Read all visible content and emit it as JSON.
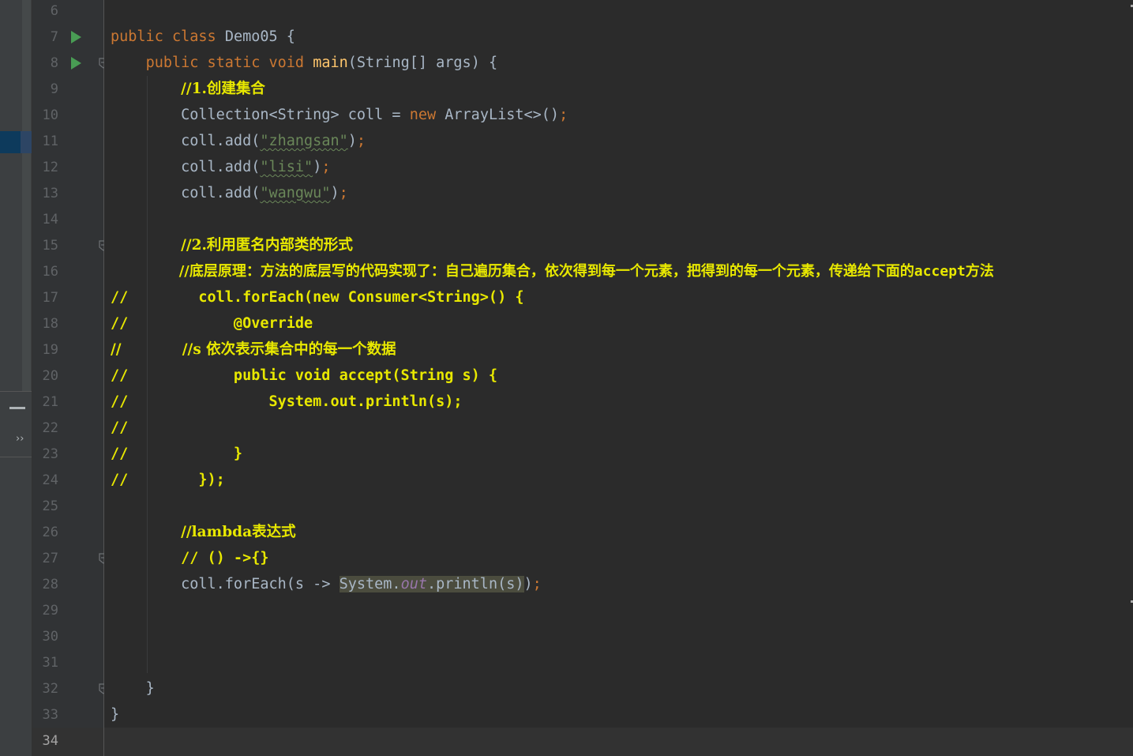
{
  "toolstrip": {
    "minimize_icon": "minus-icon",
    "expand_icon": "double-chevron-right-icon",
    "expand_glyph": "››"
  },
  "gutter": {
    "lines": [
      {
        "n": "6"
      },
      {
        "n": "7",
        "run": true
      },
      {
        "n": "8",
        "run": true,
        "fold": true
      },
      {
        "n": "9"
      },
      {
        "n": "10"
      },
      {
        "n": "11"
      },
      {
        "n": "12"
      },
      {
        "n": "13"
      },
      {
        "n": "14"
      },
      {
        "n": "15",
        "fold": true
      },
      {
        "n": "16"
      },
      {
        "n": "17"
      },
      {
        "n": "18"
      },
      {
        "n": "19"
      },
      {
        "n": "20"
      },
      {
        "n": "21"
      },
      {
        "n": "22"
      },
      {
        "n": "23"
      },
      {
        "n": "24"
      },
      {
        "n": "25"
      },
      {
        "n": "26"
      },
      {
        "n": "27",
        "fold": true
      },
      {
        "n": "28"
      },
      {
        "n": "29"
      },
      {
        "n": "30"
      },
      {
        "n": "31"
      },
      {
        "n": "32",
        "fold": true
      },
      {
        "n": "33"
      },
      {
        "n": "34",
        "current": true
      }
    ]
  },
  "code": {
    "l7_public": "public",
    "l7_class": "class",
    "l7_name": "Demo05 {",
    "l8_public": "public",
    "l8_static": "static",
    "l8_void": "void",
    "l8_main": "main",
    "l8_params": "(String[] args) {",
    "l9": "//1.创建集合",
    "l10_a": "Collection<String> coll = ",
    "l10_new": "new",
    "l10_b": " ArrayList<>()",
    "l10_semi": ";",
    "l11_a": "coll.add(",
    "l11_str": "\"zhangsan\"",
    "l11_b": ")",
    "l11_semi": ";",
    "l12_a": "coll.add(",
    "l12_str": "\"lisi\"",
    "l12_b": ")",
    "l12_semi": ";",
    "l13_a": "coll.add(",
    "l13_str": "\"wangwu\"",
    "l13_b": ")",
    "l13_semi": ";",
    "l15": "//2.利用匿名内部类的形式",
    "l16_a": "//底层原理：方法的底层写的代码实现了：自己遍历集合，依次得到每一个元素，把得到的每一个元素，传递给下面的",
    "l16_b": "accept",
    "l16_c": "方法",
    "l17": "//        coll.forEach(new Consumer<String>() {",
    "l18": "//            @Override",
    "l19": "//            //s 依次表示集合中的每一个数据",
    "l20": "//            public void accept(String s) {",
    "l21": "//                System.out.println(s);",
    "l22": "//",
    "l23": "//            }",
    "l24": "//        });",
    "l26": "//lambda表达式",
    "l27": "// () ->{}",
    "l28_a": "coll.forEach(s -> ",
    "l28_sys": "System.",
    "l28_out": "out",
    "l28_println": ".println(s)",
    "l28_b": ")",
    "l28_semi": ";",
    "l32": "}",
    "l33": "}"
  }
}
